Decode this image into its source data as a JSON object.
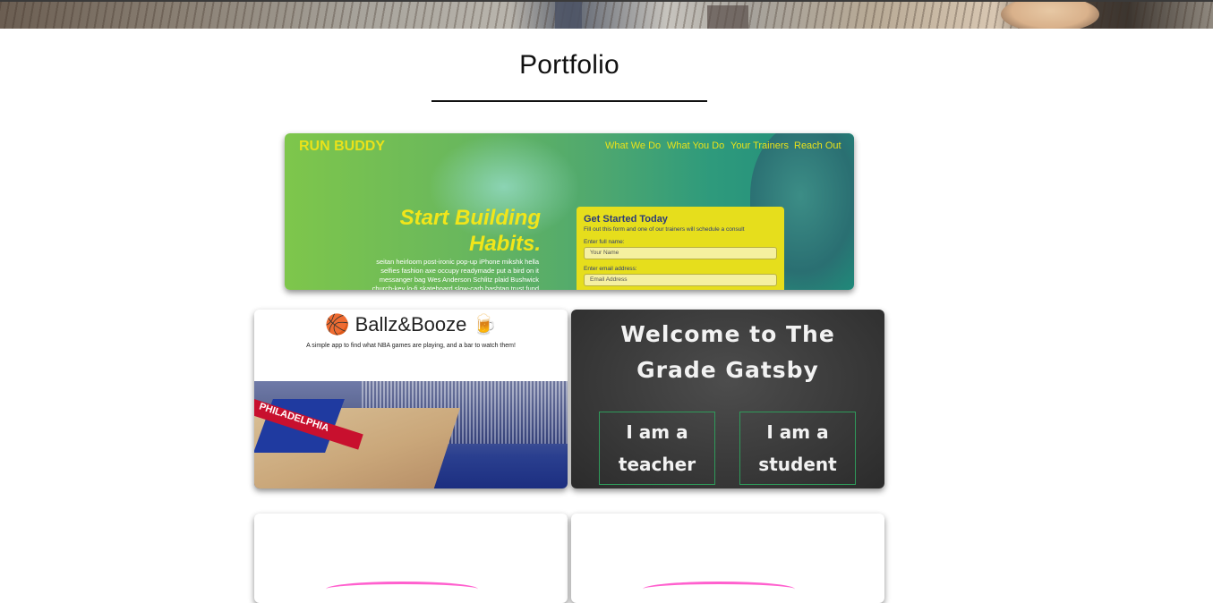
{
  "section": {
    "title": "Portfolio"
  },
  "projects": {
    "run_buddy": {
      "logo": "RUN BUDDY",
      "nav": [
        "What We Do",
        "What You Do",
        "Your Trainers",
        "Reach Out"
      ],
      "headline_line1": "Start Building",
      "headline_line2": "Habits.",
      "blurb": "seitan heirloom post-ironic pop-up iPhone mikshk hella selfies fashion axe occupy readymade put a bird on it messanger bag Wes Anderson Schlitz plaid Bushwick church-key lo-fi skateboard slow-carb hashtag trust fund",
      "form_title": "Get Started Today",
      "form_subtitle": "Fill out this form and one of our trainers will schedule a consult",
      "name_label": "Enter full name:",
      "name_placeholder": "Your Name",
      "email_label": "Enter email address:",
      "email_placeholder": "Email Address"
    },
    "ballz_booze": {
      "title": "🏀 Ballz&Booze 🍺",
      "subtitle": "A simple app to find what NBA games are playing, and a bar to watch them!",
      "banner_text": "PHILADELPHIA"
    },
    "grade_gatsby": {
      "title_line1": "Welcome to The",
      "title_line2": "Grade Gatsby",
      "teacher_button": "I am a teacher",
      "student_button": "I am a student"
    }
  },
  "colors": {
    "run_buddy_accent": "#e9e21a",
    "chalkboard": "#3a3a3a",
    "gatsby_border": "#2f9a5a",
    "scribble": "#ff4fc9"
  }
}
